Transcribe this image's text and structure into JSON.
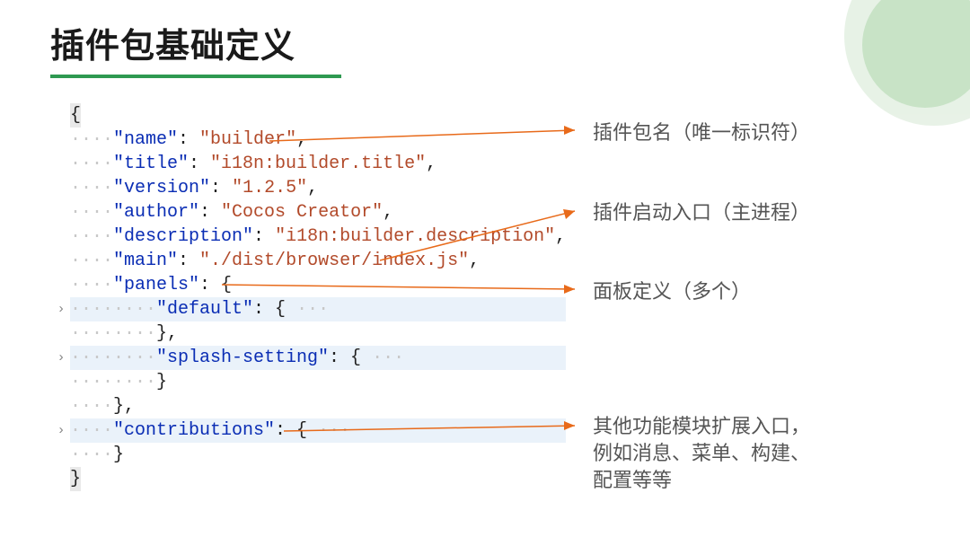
{
  "title": "插件包基础定义",
  "annotations": {
    "a1": "插件包名（唯一标识符）",
    "a2": "插件启动入口（主进程）",
    "a3": "面板定义（多个）",
    "a4": "其他功能模块扩展入口，\n例如消息、菜单、构建、\n配置等等"
  },
  "code": {
    "open_brace": "{",
    "name_key": "\"name\"",
    "name_val": "\"builder\"",
    "title_key": "\"title\"",
    "title_val": "\"i18n:builder.title\"",
    "version_key": "\"version\"",
    "version_val": "\"1.2.5\"",
    "author_key": "\"author\"",
    "author_val": "\"Cocos Creator\"",
    "desc_key": "\"description\"",
    "desc_val": "\"i18n:builder.description\"",
    "main_key": "\"main\"",
    "main_val": "\"./dist/browser/index.js\"",
    "panels_key": "\"panels\"",
    "default_key": "\"default\"",
    "splash_key": "\"splash-setting\"",
    "contrib_key": "\"contributions\"",
    "close_brace": "}",
    "dots4": "····",
    "dots8": "········",
    "fold": " ···"
  }
}
